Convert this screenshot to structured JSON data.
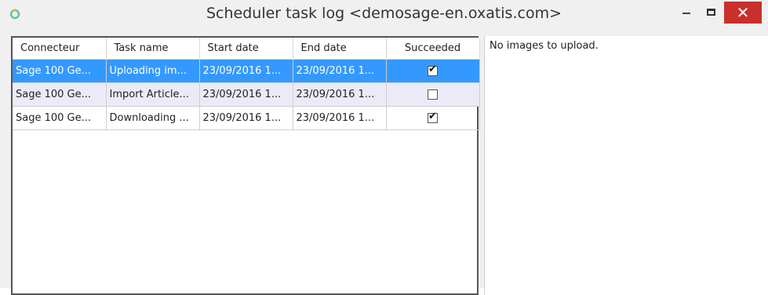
{
  "window": {
    "title": "Scheduler task log <demosage-en.oxatis.com>",
    "close_symbol": "✕"
  },
  "table": {
    "columns": [
      "Connecteur",
      "Task name",
      "Start date",
      "End date",
      "Succeeded"
    ],
    "rows": [
      {
        "connecteur": "Sage 100 Ge...",
        "task": "Uploading im...",
        "start": "23/09/2016 1...",
        "end": "23/09/2016 1...",
        "succeeded": true
      },
      {
        "connecteur": "Sage 100 Ge...",
        "task": "Import Article...",
        "start": "23/09/2016 1...",
        "end": "23/09/2016 1...",
        "succeeded": false
      },
      {
        "connecteur": "Sage 100 Ge...",
        "task": "Downloading ...",
        "start": "23/09/2016 1...",
        "end": "23/09/2016 1...",
        "succeeded": true
      }
    ],
    "selected_row": 0
  },
  "log": {
    "message": "No images to upload."
  },
  "colors": {
    "selection": "#3399ff",
    "close_button": "#c9302c",
    "app_icon": "#5cc7a0"
  }
}
